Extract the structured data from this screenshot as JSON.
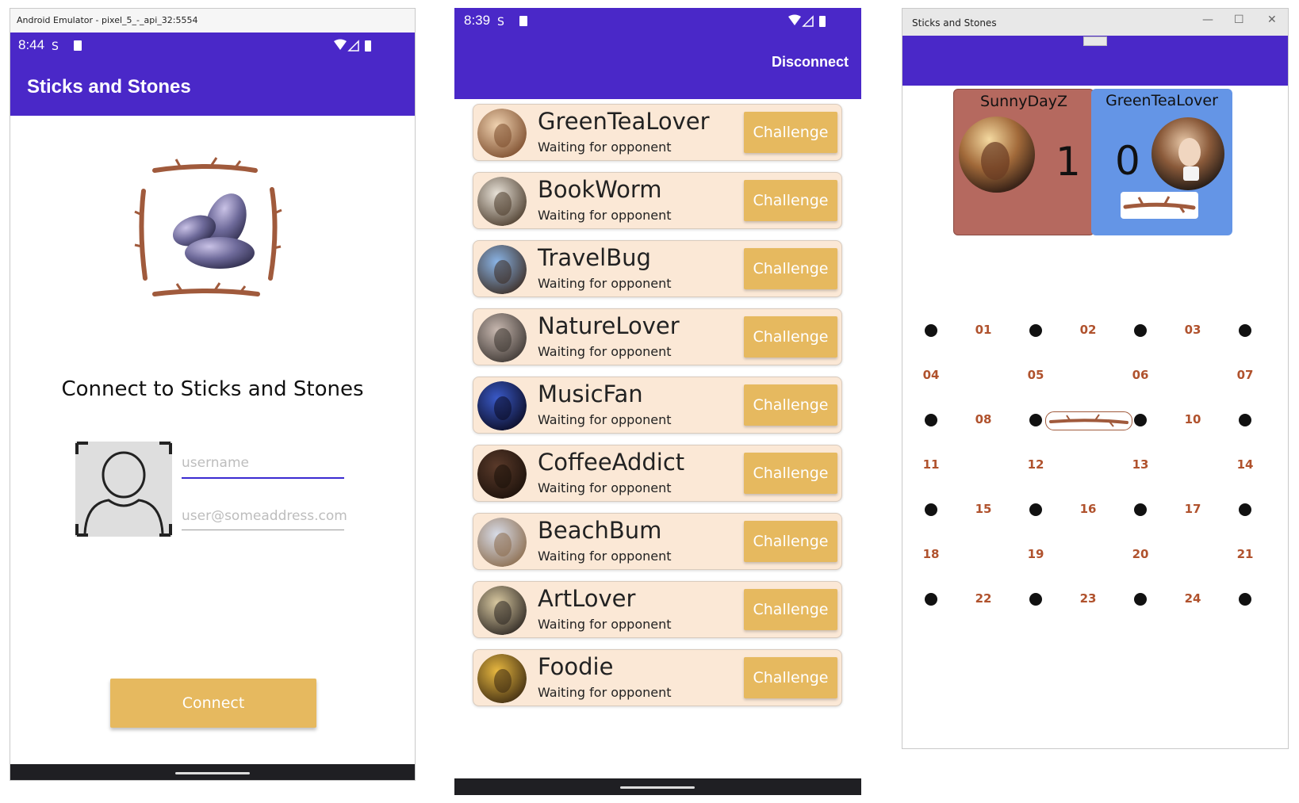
{
  "emulator": {
    "window_title": "Android Emulator - pixel_5_-_api_32:5554",
    "status_time": "8:44",
    "app_title": "Sticks and Stones",
    "heading": "Connect to Sticks and Stones",
    "username_placeholder": "username",
    "email_placeholder": "user@someaddress.com",
    "connect_label": "Connect",
    "underline_color": "#3b2bd1",
    "accent": "#e6b95f",
    "bar_color": "#4a28c8"
  },
  "lobby": {
    "status_time": "8:39",
    "disconnect_label": "Disconnect",
    "players": [
      {
        "name": "GreenTeaLover",
        "status": "Waiting for opponent",
        "action": "Challenge",
        "avatar_icon": "woman-drinking-tea-avatar"
      },
      {
        "name": "BookWorm",
        "status": "Waiting for opponent",
        "action": "Challenge",
        "avatar_icon": "cartoon-worm-avatar"
      },
      {
        "name": "TravelBug",
        "status": "Waiting for opponent",
        "action": "Challenge",
        "avatar_icon": "car-avatar"
      },
      {
        "name": "NatureLover",
        "status": "Waiting for opponent",
        "action": "Challenge",
        "avatar_icon": "nature-avatar"
      },
      {
        "name": "MusicFan",
        "status": "Waiting for opponent",
        "action": "Challenge",
        "avatar_icon": "concert-avatar"
      },
      {
        "name": "CoffeeAddict",
        "status": "Waiting for opponent",
        "action": "Challenge",
        "avatar_icon": "coffee-avatar"
      },
      {
        "name": "BeachBum",
        "status": "Waiting for opponent",
        "action": "Challenge",
        "avatar_icon": "beach-avatar"
      },
      {
        "name": "ArtLover",
        "status": "Waiting for opponent",
        "action": "Challenge",
        "avatar_icon": "art-avatar"
      },
      {
        "name": "Foodie",
        "status": "Waiting for opponent",
        "action": "Challenge",
        "avatar_icon": "foodie-avatar"
      }
    ]
  },
  "game": {
    "window_title": "Sticks and Stones",
    "player1": {
      "name": "SunnyDayZ",
      "score": "1",
      "color": "#b5695f"
    },
    "player2": {
      "name": "GreenTeaLover",
      "score": "0",
      "color": "#6495e6"
    },
    "labels": [
      "01",
      "02",
      "03",
      "04",
      "05",
      "06",
      "07",
      "08",
      "10",
      "11",
      "12",
      "13",
      "14",
      "15",
      "16",
      "17",
      "18",
      "19",
      "20",
      "21",
      "22",
      "23",
      "24"
    ],
    "placed_stick_position": "09"
  }
}
